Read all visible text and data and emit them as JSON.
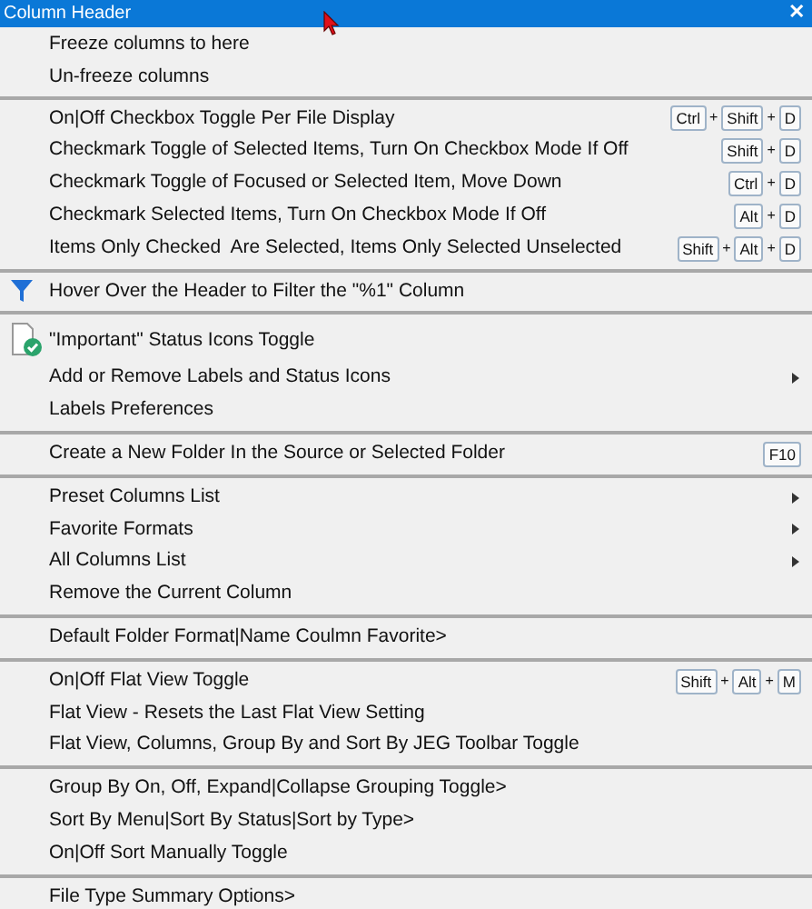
{
  "window": {
    "title": "Column Header",
    "close": "✕"
  },
  "sections": [
    {
      "items": [
        {
          "label": "Freeze columns to here"
        },
        {
          "label": "Un-freeze columns"
        }
      ]
    },
    {
      "items": [
        {
          "label": "On|Off Checkbox Toggle Per File Display",
          "keys": [
            "Ctrl",
            "Shift",
            "D"
          ]
        },
        {
          "label": "Checkmark Toggle of Selected Items, Turn On Checkbox Mode If Off",
          "keys": [
            "Shift",
            "D"
          ]
        },
        {
          "label": "Checkmark Toggle of Focused or Selected Item, Move Down",
          "keys": [
            "Ctrl",
            "D"
          ]
        },
        {
          "label": "Checkmark Selected Items, Turn On Checkbox Mode If Off",
          "keys": [
            "Alt",
            "D"
          ]
        },
        {
          "label": "Items Only Checked  Are Selected, Items Only Selected Unselected",
          "keys": [
            "Shift",
            "Alt",
            "D"
          ]
        }
      ]
    },
    {
      "items": [
        {
          "label": "Hover Over the Header to Filter the \"%1\" Column",
          "kind": "filter"
        }
      ]
    },
    {
      "items": [
        {
          "label": "\"Important\" Status Icons Toggle",
          "kind": "document-check"
        },
        {
          "label": "Add or Remove Labels and Status Icons",
          "submenu": true
        },
        {
          "label": "Labels Preferences"
        }
      ]
    },
    {
      "items": [
        {
          "label": "Create a New Folder In the Source or Selected Folder",
          "keys": [
            "F10"
          ]
        }
      ]
    },
    {
      "items": [
        {
          "label": "Preset Columns List",
          "submenu": true
        },
        {
          "label": "Favorite Formats",
          "submenu": true
        },
        {
          "label": "All Columns List",
          "submenu": true
        },
        {
          "label": "Remove the Current Column"
        }
      ]
    },
    {
      "items": [
        {
          "label": "Default Folder Format|Name Coulmn Favorite>"
        }
      ]
    },
    {
      "items": [
        {
          "label": "On|Off Flat View Toggle",
          "keys": [
            "Shift",
            "Alt",
            "M"
          ]
        },
        {
          "label": "Flat View - Resets the Last Flat View Setting"
        },
        {
          "label": "Flat View, Columns, Group By and Sort By JEG Toolbar Toggle"
        }
      ]
    },
    {
      "items": [
        {
          "label": "Group By On, Off, Expand|Collapse Grouping Toggle>"
        },
        {
          "label": "Sort By Menu|Sort By Status|Sort by Type>"
        },
        {
          "label": "On|Off Sort Manually Toggle"
        }
      ]
    },
    {
      "items": [
        {
          "label": "File Type Summary Options>"
        }
      ]
    }
  ],
  "key_joiner": "+"
}
